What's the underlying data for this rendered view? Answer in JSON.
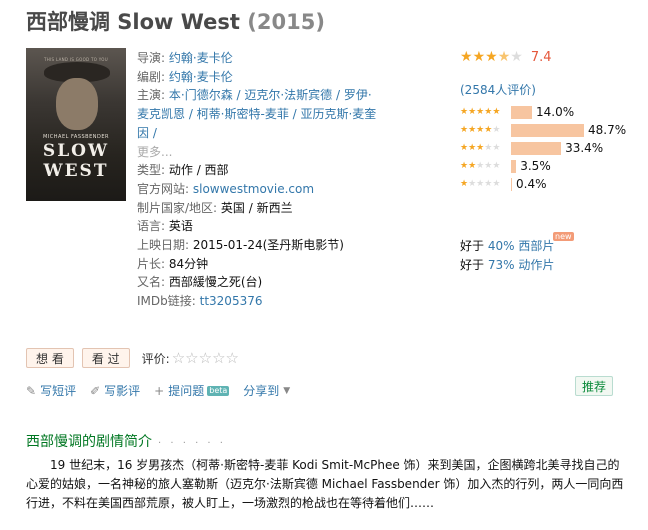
{
  "title": {
    "name": "西部慢调 Slow West",
    "year": "(2015)"
  },
  "poster": {
    "tagline": "THIS LAND IS GOOD TO YOU",
    "actor": "MICHAEL FASSBENDER",
    "line1": "SLOW",
    "line2": "WEST"
  },
  "info": {
    "director_label": "导演:",
    "director": "约翰·麦卡伦",
    "writer_label": "编剧:",
    "writer": "约翰·麦卡伦",
    "cast_label": "主演:",
    "cast": "本·门德尔森 / 迈克尔·法斯宾德 / 罗伊·麦克凯恩 / 柯蒂·斯密特-麦菲 / 亚历克斯·麦奎因 /",
    "more": "更多...",
    "genre_label": "类型:",
    "genre": "动作 / 西部",
    "site_label": "官方网站:",
    "site": "slowwestmovie.com",
    "country_label": "制片国家/地区:",
    "country": "英国 / 新西兰",
    "language_label": "语言:",
    "language": "英语",
    "release_label": "上映日期:",
    "release": "2015-01-24(圣丹斯电影节)",
    "runtime_label": "片长:",
    "runtime": "84分钟",
    "aka_label": "又名:",
    "aka": "西部緩慢之死(台)",
    "imdb_label": "IMDb链接:",
    "imdb": "tt3205376"
  },
  "rating": {
    "score": "7.4",
    "stars": 3.5,
    "votes": "(2584人评价)",
    "distribution": [
      {
        "stars": 5,
        "pct": "14.0%",
        "value": 14.0
      },
      {
        "stars": 4,
        "pct": "48.7%",
        "value": 48.7
      },
      {
        "stars": 3,
        "pct": "33.4%",
        "value": 33.4
      },
      {
        "stars": 2,
        "pct": "3.5%",
        "value": 3.5
      },
      {
        "stars": 1,
        "pct": "0.4%",
        "value": 0.4
      }
    ],
    "better1_prefix": "好于",
    "better1_link": "40% 西部片",
    "better2_prefix": "好于",
    "better2_link": "73% 动作片",
    "new_badge": "new"
  },
  "actions": {
    "want": "想 看",
    "seen": "看 过",
    "rate_label": "评价:"
  },
  "toolbar": {
    "short_review": "写短评",
    "review": "写影评",
    "ask": "提问题",
    "beta": "beta",
    "share": "分享到",
    "recommend": "推荐"
  },
  "summary": {
    "title": "西部慢调的剧情简介",
    "dots": "· · · · · ·",
    "text": "19 世纪末，16 岁男孩杰（柯蒂·斯密特-麦菲 Kodi Smit-McPhee 饰）来到美国，企图横跨北美寻找自己的心爱的姑娘，一名神秘的旅人塞勒斯（迈克尔·法斯宾德 Michael Fassbender 饰）加入杰的行列，两人一同向西行进，不料在美国西部荒原，被人盯上，一场激烈的枪战也在等待着他们……"
  },
  "colors": {
    "accent": "#3377aa",
    "score": "#e5573b",
    "bar": "#f7c5a0",
    "section": "#007722"
  }
}
